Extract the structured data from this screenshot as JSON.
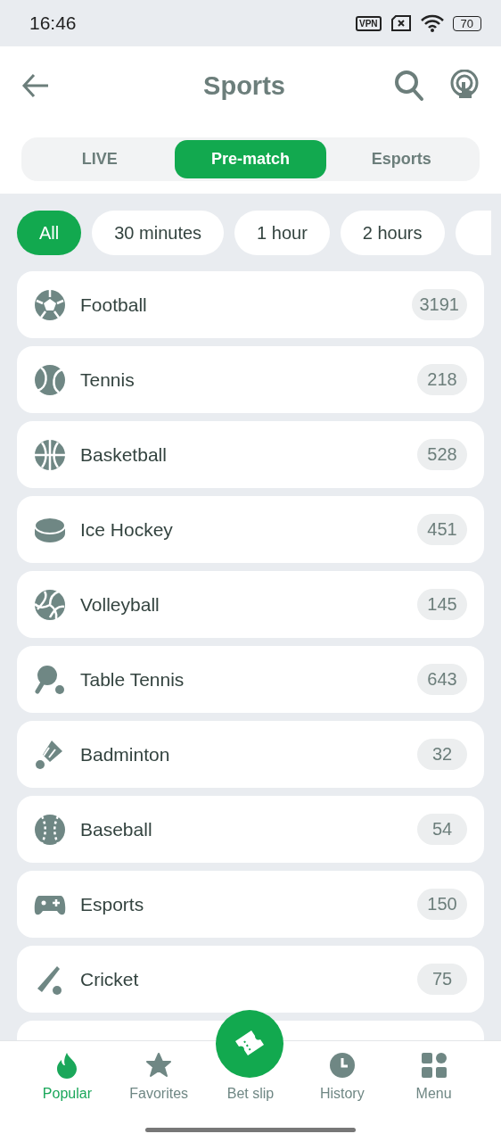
{
  "status_bar": {
    "time": "16:46",
    "vpn": "VPN",
    "battery": "70"
  },
  "header": {
    "title": "Sports"
  },
  "tabs": [
    {
      "label": "LIVE",
      "selected": false
    },
    {
      "label": "Pre-match",
      "selected": true
    },
    {
      "label": "Esports",
      "selected": false
    }
  ],
  "time_filters": [
    {
      "label": "All",
      "selected": true
    },
    {
      "label": "30 minutes",
      "selected": false
    },
    {
      "label": "1 hour",
      "selected": false
    },
    {
      "label": "2 hours",
      "selected": false
    }
  ],
  "sports": [
    {
      "kind": "football",
      "name": "Football",
      "count": "3191"
    },
    {
      "kind": "tennis",
      "name": "Tennis",
      "count": "218"
    },
    {
      "kind": "basketball",
      "name": "Basketball",
      "count": "528"
    },
    {
      "kind": "hockey",
      "name": "Ice Hockey",
      "count": "451"
    },
    {
      "kind": "volleyball",
      "name": "Volleyball",
      "count": "145"
    },
    {
      "kind": "tabletennis",
      "name": "Table Tennis",
      "count": "643"
    },
    {
      "kind": "badminton",
      "name": "Badminton",
      "count": "32"
    },
    {
      "kind": "baseball",
      "name": "Baseball",
      "count": "54"
    },
    {
      "kind": "esports",
      "name": "Esports",
      "count": "150"
    },
    {
      "kind": "cricket",
      "name": "Cricket",
      "count": "75"
    }
  ],
  "bottom_nav": [
    {
      "kind": "popular",
      "label": "Popular",
      "selected": true
    },
    {
      "kind": "favorites",
      "label": "Favorites",
      "selected": false
    },
    {
      "kind": "betslip",
      "label": "Bet slip",
      "selected": false
    },
    {
      "kind": "history",
      "label": "History",
      "selected": false
    },
    {
      "kind": "menu",
      "label": "Menu",
      "selected": false
    }
  ]
}
